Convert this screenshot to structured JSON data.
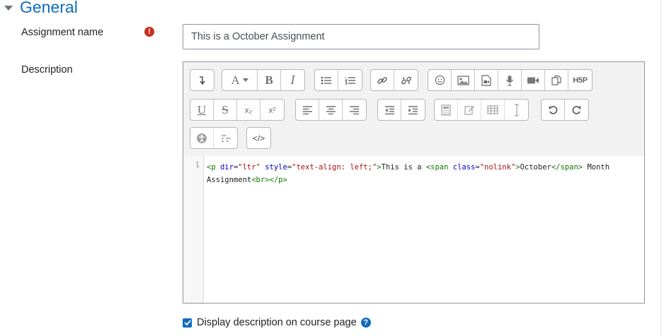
{
  "section": {
    "title": "General"
  },
  "assignment_name": {
    "label": "Assignment name",
    "required_icon": "exclamation-circle-icon",
    "value": "This is a October Assignment"
  },
  "description": {
    "label": "Description",
    "toolbar": {
      "font_label": "A",
      "bold_label": "B",
      "italic_label": "I",
      "underline_label": "U",
      "strike_label": "S",
      "subscript_label": "x₂",
      "superscript_label": "x²",
      "h5p_label": "H5P",
      "html_label": "</>"
    },
    "code": {
      "line_number": "1",
      "tokens": {
        "t1": "<p",
        "a1": "dir",
        "e1": "=",
        "s1": "\"ltr\"",
        "a2": "style",
        "e2": "=",
        "s2": "\"text-align: left;\"",
        "t2": ">",
        "txt1": "This is a ",
        "t3": "<span",
        "a3": "class",
        "e3": "=",
        "s3": "\"nolink\"",
        "t4": ">",
        "txt2": "October",
        "t5": "</span>",
        "txt3": " Month Assignment",
        "t6": "<br>",
        "t7": "</p>"
      }
    }
  },
  "display_description": {
    "label": "Display description on course page",
    "checked": true,
    "help_icon": "question-circle-icon"
  }
}
